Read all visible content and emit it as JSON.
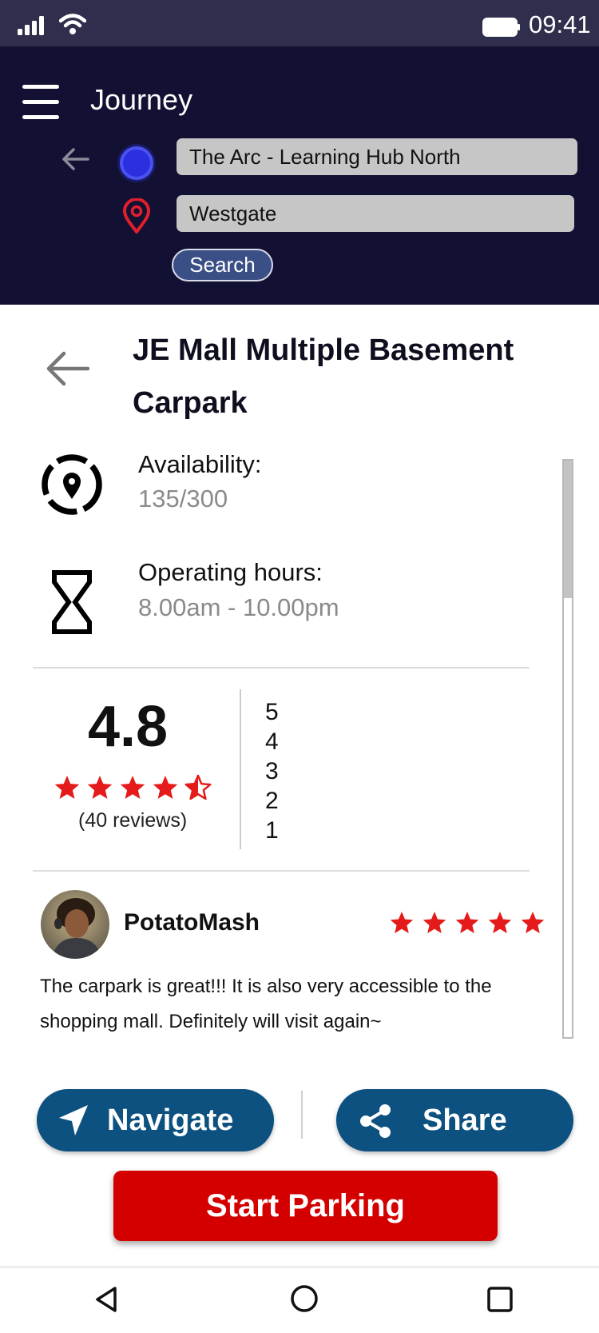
{
  "status_bar": {
    "time": "09:41",
    "icons": [
      "signal-icon",
      "wifi-icon",
      "battery-icon"
    ]
  },
  "header": {
    "title": "Journey",
    "origin_value": "The Arc - Learning Hub North",
    "destination_value": "Westgate",
    "search_label": "Search",
    "icons": [
      "menu-icon",
      "back-arrow-icon",
      "origin-dot-icon",
      "location-pin-icon"
    ]
  },
  "place": {
    "name": "JE Mall Multiple Basement Carpark",
    "availability_label": "Availability:",
    "availability_value": "135/300",
    "hours_label": "Operating hours:",
    "hours_value": "8.00am - 10.00pm"
  },
  "rating": {
    "score": "4.8",
    "stars": 4.5,
    "reviews_count": "(40 reviews)",
    "levels": [
      "5",
      "4",
      "3",
      "2",
      "1"
    ]
  },
  "review": {
    "user": "PotatoMash",
    "stars": 5,
    "text": "The carpark is great!!! It is also very accessible to the shopping mall. Definitely will visit again~"
  },
  "actions": {
    "navigate_label": "Navigate",
    "share_label": "Share",
    "start_label": "Start Parking"
  },
  "colors": {
    "status_bar": "#2f2f4d",
    "header": "#121033",
    "pill_button": "#0d5181",
    "start_button": "#d40000",
    "star": "#e51a1a"
  }
}
